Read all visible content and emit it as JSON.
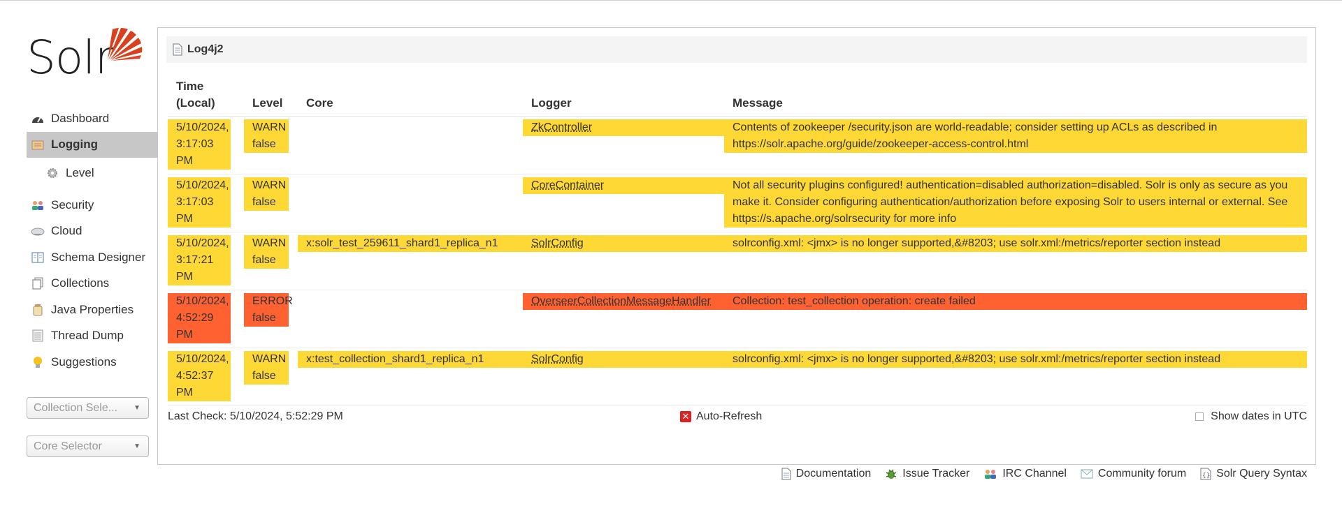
{
  "brand": {
    "logo_text": "Solr",
    "logo_color": "#d9411e"
  },
  "sidebar": {
    "items": [
      {
        "label": "Dashboard",
        "icon": "dashboard-icon"
      },
      {
        "label": "Logging",
        "icon": "logging-icon",
        "active": true
      },
      {
        "label": "Level",
        "icon": "gear-icon",
        "sub": true
      },
      {
        "label": "Security",
        "icon": "security-icon"
      },
      {
        "label": "Cloud",
        "icon": "cloud-icon"
      },
      {
        "label": "Schema Designer",
        "icon": "book-icon"
      },
      {
        "label": "Collections",
        "icon": "collections-icon"
      },
      {
        "label": "Java Properties",
        "icon": "jar-icon"
      },
      {
        "label": "Thread Dump",
        "icon": "thread-icon"
      },
      {
        "label": "Suggestions",
        "icon": "lightbulb-icon"
      }
    ],
    "collection_selector": "Collection Sele...",
    "core_selector": "Core Selector"
  },
  "panel": {
    "title": "Log4j2",
    "columns": {
      "time": "Time (Local)",
      "level": "Level",
      "core": "Core",
      "logger": "Logger",
      "message": "Message"
    },
    "rows": [
      {
        "time": "5/10/2024, 3:17:03 PM",
        "level": "WARN",
        "flag": "false",
        "core": "",
        "logger": "ZkController",
        "message": "Contents of zookeeper /security.json are world-readable; consider setting up ACLs as described in https://solr.apache.org/guide/zookeeper-access-control.html",
        "severity": "warn"
      },
      {
        "time": "5/10/2024, 3:17:03 PM",
        "level": "WARN",
        "flag": "false",
        "core": "",
        "logger": "CoreContainer",
        "message": "Not all security plugins configured! authentication=disabled authorization=disabled. Solr is only as secure as you make it. Consider configuring authentication/authorization before exposing Solr to users internal or external. See https://s.apache.org/solrsecurity for more info",
        "severity": "warn"
      },
      {
        "time": "5/10/2024, 3:17:21 PM",
        "level": "WARN",
        "flag": "false",
        "core": "x:solr_test_259611_shard1_replica_n1",
        "logger": "SolrConfig",
        "message": "solrconfig.xml: <jmx> is no longer supported,&#8203; use solr.xml:/metrics/reporter section instead",
        "severity": "warn"
      },
      {
        "time": "5/10/2024, 4:52:29 PM",
        "level": "ERROR",
        "flag": "false",
        "core": "",
        "logger": "OverseerCollectionMessageHandler",
        "message": "Collection: test_collection operation: create failed",
        "severity": "error"
      },
      {
        "time": "5/10/2024, 4:52:37 PM",
        "level": "WARN",
        "flag": "false",
        "core": "x:test_collection_shard1_replica_n1",
        "logger": "SolrConfig",
        "message": "solrconfig.xml: <jmx> is no longer supported,&#8203; use solr.xml:/metrics/reporter section instead",
        "severity": "warn"
      }
    ],
    "last_check": "Last Check: 5/10/2024, 5:52:29 PM",
    "auto_refresh": "Auto-Refresh",
    "show_utc": "Show dates in UTC"
  },
  "colors": {
    "warn": "#fed835",
    "error": "#ff6131"
  },
  "footer_links": [
    {
      "label": "Documentation",
      "icon": "document-icon"
    },
    {
      "label": "Issue Tracker",
      "icon": "bug-icon"
    },
    {
      "label": "IRC Channel",
      "icon": "irc-icon"
    },
    {
      "label": "Community forum",
      "icon": "mail-icon"
    },
    {
      "label": "Solr Query Syntax",
      "icon": "query-syntax-icon"
    }
  ]
}
